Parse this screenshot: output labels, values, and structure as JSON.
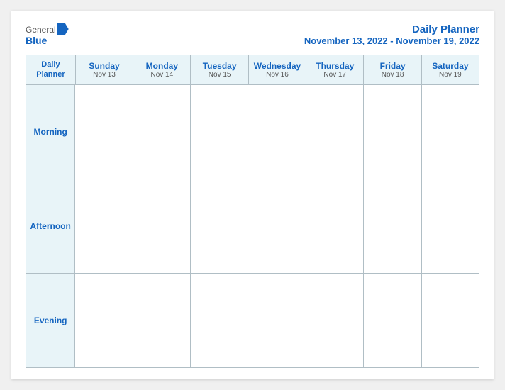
{
  "logo": {
    "general": "General",
    "blue": "Blue",
    "icon_label": "blue-arrow-icon"
  },
  "header": {
    "title": "Daily Planner",
    "date_range": "November 13, 2022 - November 19, 2022"
  },
  "columns": [
    {
      "id": "label",
      "day_name": "Daily",
      "day_name2": "Planner",
      "date": ""
    },
    {
      "id": "sun",
      "day_name": "Sunday",
      "date": "Nov 13"
    },
    {
      "id": "mon",
      "day_name": "Monday",
      "date": "Nov 14"
    },
    {
      "id": "tue",
      "day_name": "Tuesday",
      "date": "Nov 15"
    },
    {
      "id": "wed",
      "day_name": "Wednesday",
      "date": "Nov 16"
    },
    {
      "id": "thu",
      "day_name": "Thursday",
      "date": "Nov 17"
    },
    {
      "id": "fri",
      "day_name": "Friday",
      "date": "Nov 18"
    },
    {
      "id": "sat",
      "day_name": "Saturday",
      "date": "Nov 19"
    }
  ],
  "rows": [
    {
      "id": "morning",
      "label": "Morning"
    },
    {
      "id": "afternoon",
      "label": "Afternoon"
    },
    {
      "id": "evening",
      "label": "Evening"
    }
  ]
}
